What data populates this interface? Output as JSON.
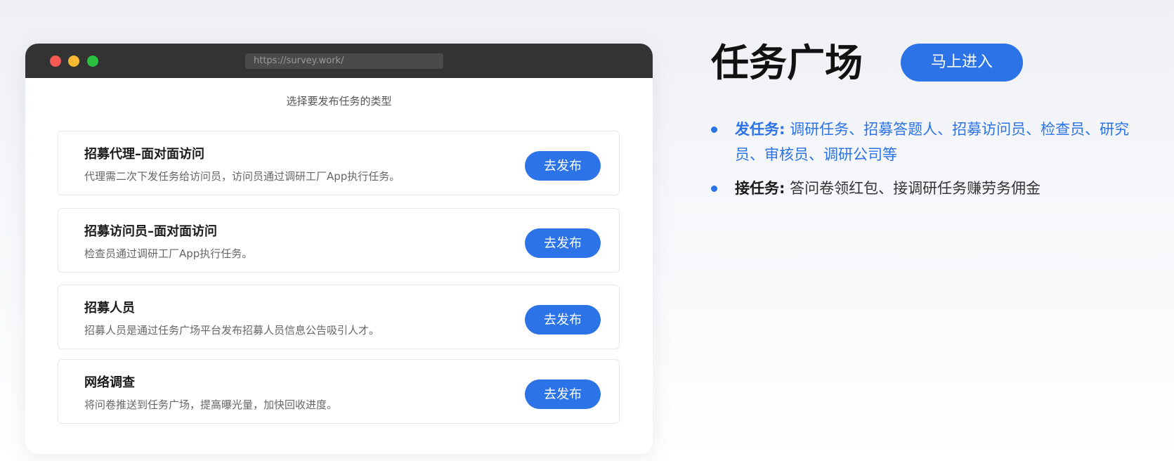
{
  "browser": {
    "url": "https://survey.work/",
    "prompt": "选择要发布任务的类型",
    "cards": [
      {
        "title": "招募代理–面对面访问",
        "desc": "代理需二次下发任务给访问员，访问员通过调研工厂App执行任务。",
        "button": "去发布"
      },
      {
        "title": "招募访问员–面对面访问",
        "desc": "检查员通过调研工厂App执行任务。",
        "button": "去发布"
      },
      {
        "title": "招募人员",
        "desc": "招募人员是通过任务广场平台发布招募人员信息公告吸引人才。",
        "button": "去发布"
      },
      {
        "title": "网络调查",
        "desc": "将问卷推送到任务广场，提高曝光量，加快回收进度。",
        "button": "去发布"
      }
    ]
  },
  "side": {
    "heading": "任务广场",
    "enter_button": "马上进入",
    "bullets": [
      {
        "key": "发任务:",
        "value": "调研任务、招募答题人、招募访问员、检查员、研究员、审核员、调研公司等"
      },
      {
        "key": "接任务:",
        "value": "答问卷领红包、接调研任务赚劳务佣金"
      }
    ]
  },
  "colors": {
    "accent": "#2b73e6",
    "titlebar": "#333333"
  }
}
